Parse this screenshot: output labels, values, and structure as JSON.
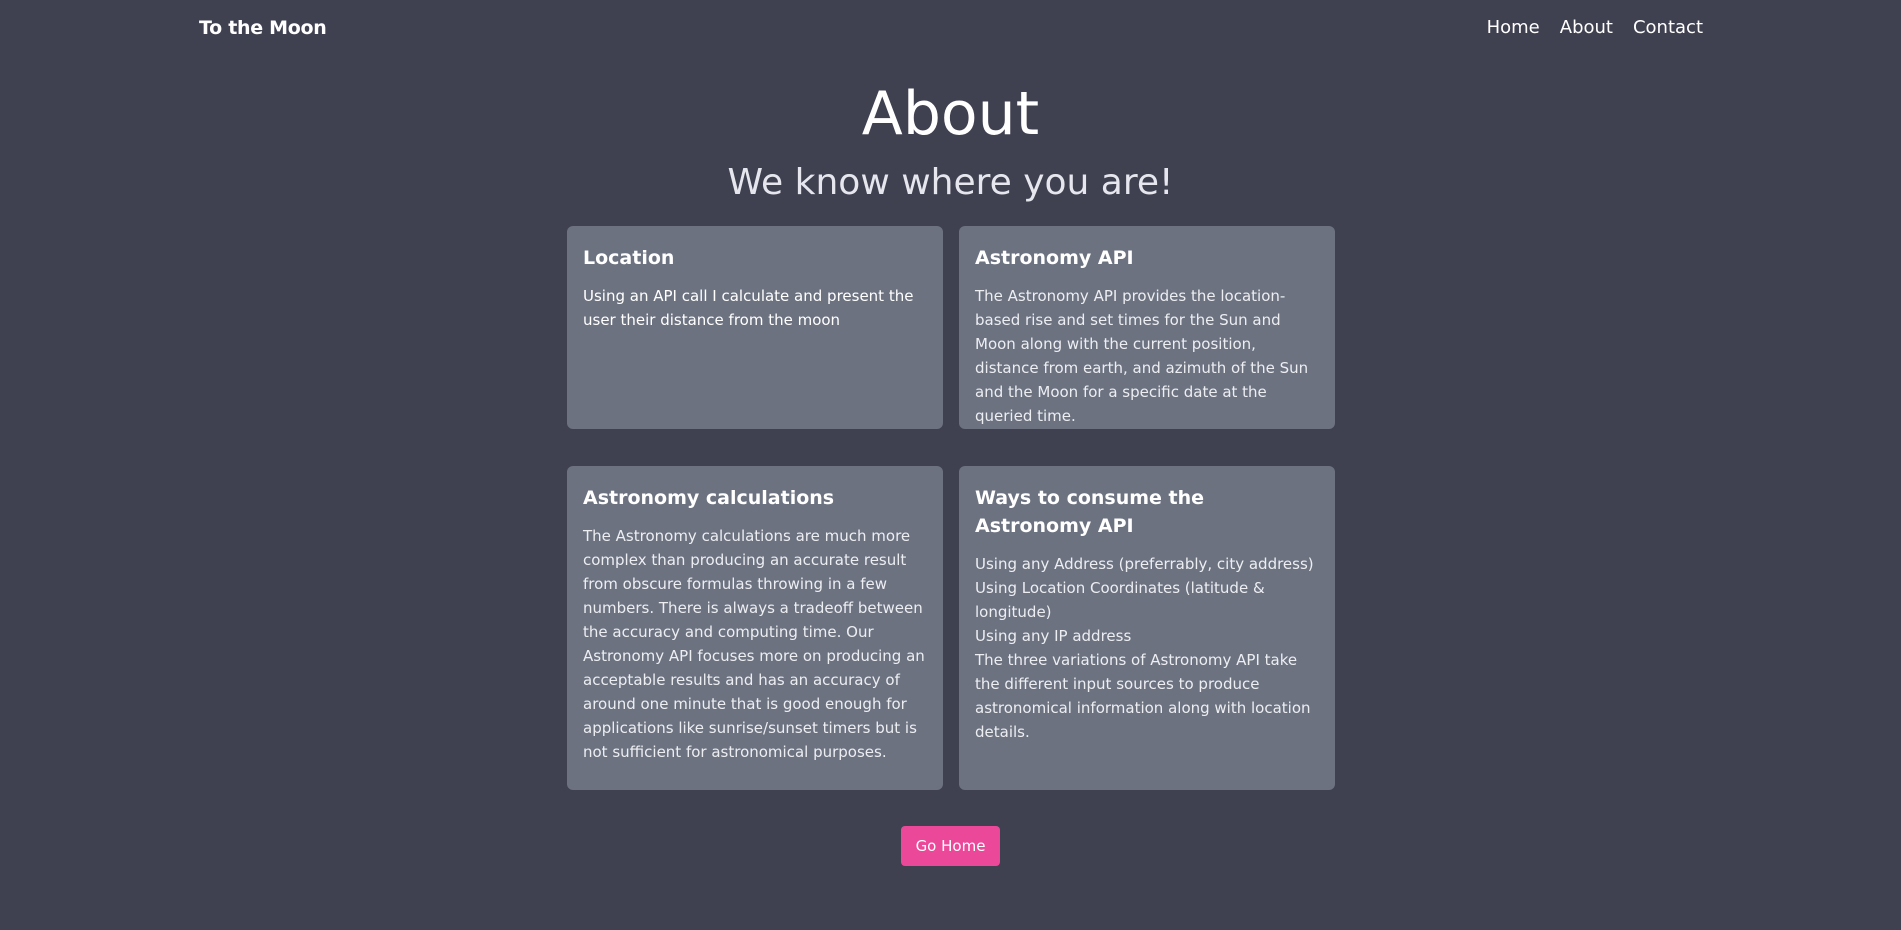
{
  "nav": {
    "brand": "To the Moon",
    "links": [
      "Home",
      "About",
      "Contact"
    ]
  },
  "header": {
    "title": "About",
    "subtitle": "We know where you are!"
  },
  "cards": [
    {
      "title": "Location",
      "lines": [
        "Using an API call I calculate and present the user their distance from the moon"
      ]
    },
    {
      "title": "Astronomy API",
      "lines": [
        "The Astronomy API provides the location-based rise and set times for the Sun and Moon along with the current position, distance from earth, and azimuth of the Sun and the Moon for a specific date at the queried time."
      ]
    },
    {
      "title": "Astronomy calculations",
      "lines": [
        "The Astronomy calculations are much more complex than producing an accurate result from obscure formulas throwing in a few numbers. There is always a tradeoff between the accuracy and computing time. Our Astronomy API focuses more on producing an acceptable results and has an accuracy of around one minute that is good enough for applications like sunrise/sunset timers but is not sufficient for astronomical purposes."
      ]
    },
    {
      "title": "Ways to consume the Astronomy API",
      "lines": [
        "Using any Address (preferrably, city address)",
        "Using Location Coordinates (latitude & longitude)",
        "Using any IP address",
        "The three variations of Astronomy API take the different input sources to produce astronomical information along with location details."
      ]
    }
  ],
  "button": {
    "label": "Go Home"
  },
  "colors": {
    "background": "#3f4050",
    "card": "#6c7280",
    "button": "#ec4899"
  }
}
